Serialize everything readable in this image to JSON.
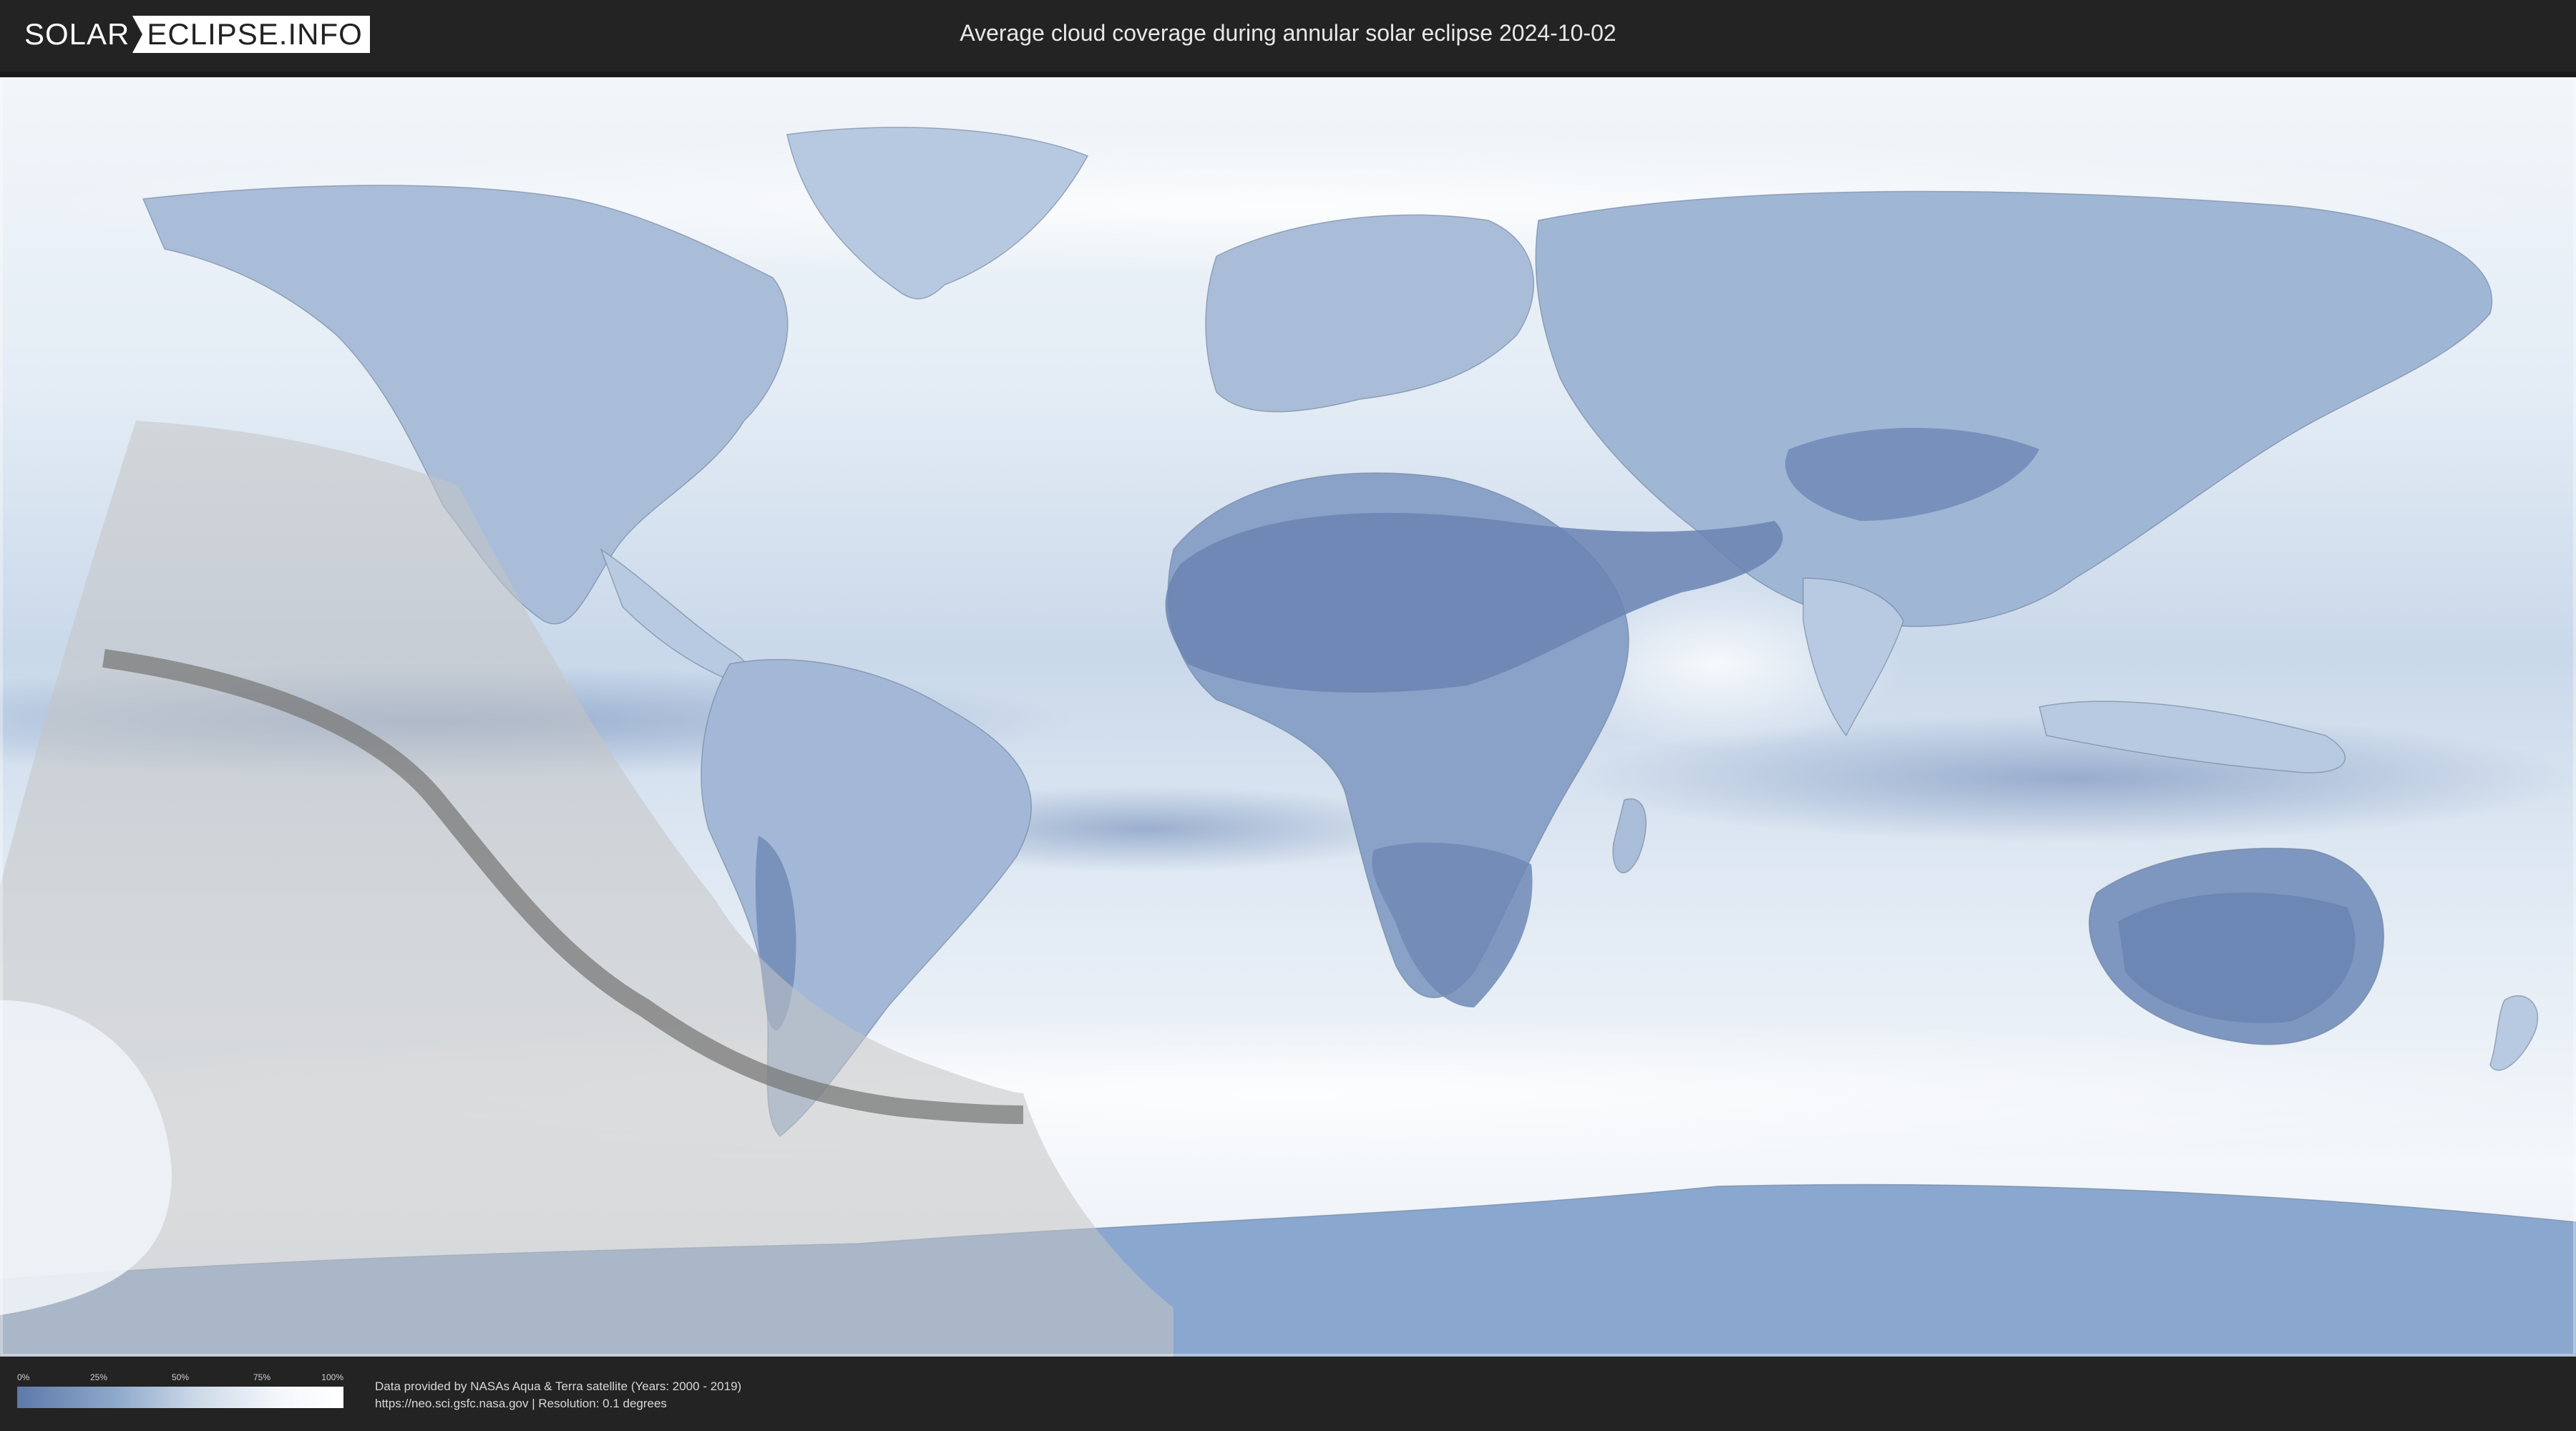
{
  "header": {
    "logo_left": "SOLAR",
    "logo_right": "ECLIPSE.INFO",
    "title": "Average cloud coverage during annular solar eclipse 2024-10-02"
  },
  "legend": {
    "ticks": [
      "0%",
      "25%",
      "50%",
      "75%",
      "100%"
    ],
    "colors": [
      "#5d79a8",
      "#8ea8cb",
      "#cdd9e8",
      "#f4f7fb",
      "#ffffff"
    ]
  },
  "footer": {
    "credit_line1": "Data provided by NASAs Aqua & Terra satellite (Years: 2000 - 2019)",
    "credit_line2": "https://neo.sci.gsfc.nasa.gov | Resolution: 0.1 degrees"
  },
  "map": {
    "land_cloud_color": "#6f8ab7",
    "ocean_cloud_color": "#e6eef6",
    "eclipse_zone_color": "#bdbdbd",
    "annular_path_color": "#7a7a7a"
  }
}
